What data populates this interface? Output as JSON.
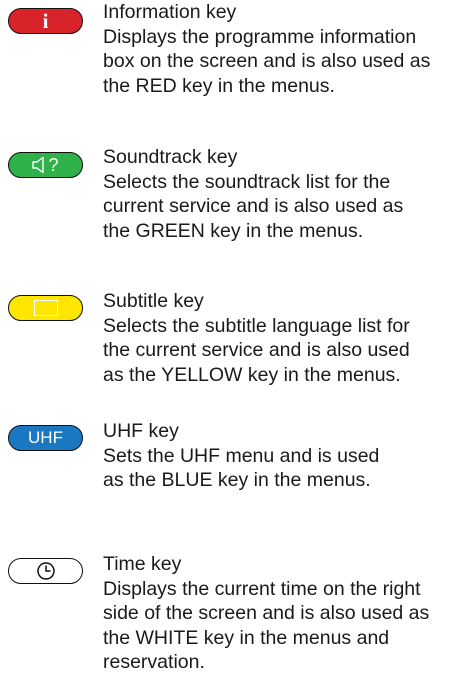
{
  "keys": [
    {
      "id": "info",
      "button_text": "i",
      "button_color": "#d8232a",
      "icon": "info-icon",
      "title": "Information key",
      "lines": [
        "Displays the programme information",
        "box on the screen and is also used as",
        "the RED key in the menus."
      ]
    },
    {
      "id": "sound",
      "button_text": "?",
      "button_color": "#2fb24a",
      "icon": "speaker-icon",
      "title": "Soundtrack key",
      "lines": [
        "Selects the soundtrack list for the",
        "current service and is also used as",
        "the GREEN key in the menus."
      ]
    },
    {
      "id": "subtitle",
      "button_color": "#ffe600",
      "icon": "subtitle-box-icon",
      "title": "Subtitle key",
      "lines": [
        "Selects the subtitle language list for",
        "the current service and is also used",
        "as the YELLOW key in the menus."
      ]
    },
    {
      "id": "uhf",
      "button_text": "UHF",
      "button_color": "#1a78c2",
      "title": "UHF key",
      "lines": [
        "Sets the UHF menu and is used",
        "as the BLUE key in the menus."
      ]
    },
    {
      "id": "time",
      "button_color": "#ffffff",
      "icon": "clock-icon",
      "title": "Time key",
      "lines": [
        "Displays the current time on the right",
        "side of the screen and is also used as",
        "the WHITE key in the menus and",
        "reservation."
      ]
    }
  ]
}
